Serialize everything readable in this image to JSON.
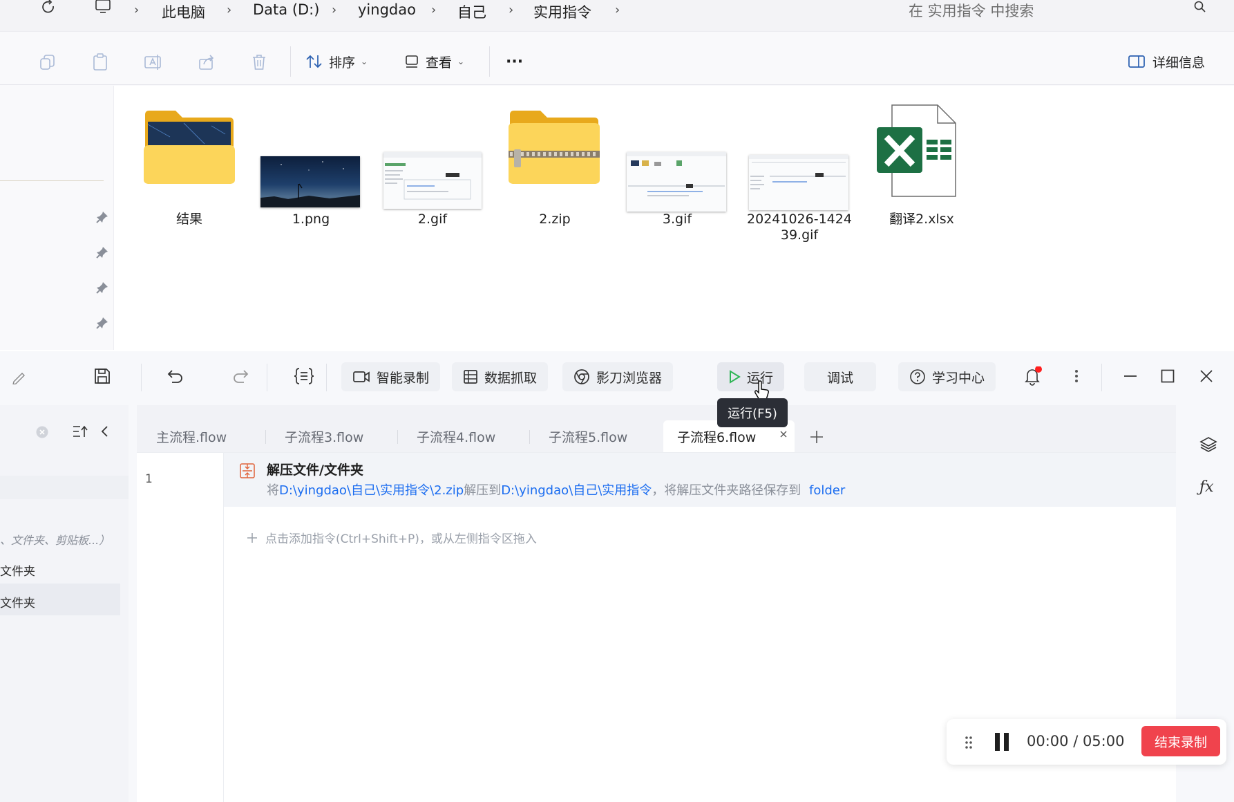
{
  "explorer": {
    "breadcrumb": [
      "此电脑",
      "Data (D:)",
      "yingdao",
      "自己",
      "实用指令"
    ],
    "search_placeholder": "在 实用指令 中搜索",
    "toolbar": {
      "sort_label": "排序",
      "view_label": "查看",
      "more_label": "···",
      "details_label": "详细信息"
    },
    "files": [
      {
        "name": "结果",
        "type": "folder"
      },
      {
        "name": "1.png",
        "type": "image"
      },
      {
        "name": "2.gif",
        "type": "gif"
      },
      {
        "name": "2.zip",
        "type": "zip"
      },
      {
        "name": "3.gif",
        "type": "gif"
      },
      {
        "name": "20241026-142439.gif",
        "name_line1": "20241026-1424",
        "name_line2": "39.gif",
        "type": "gif"
      },
      {
        "name": "翻译2.xlsx",
        "type": "xlsx"
      }
    ]
  },
  "app": {
    "toolbar": {
      "smart_record": "智能录制",
      "data_capture": "数据抓取",
      "browser": "影刀浏览器",
      "run": "运行",
      "debug": "调试",
      "learning_center": "学习中心",
      "run_tooltip": "运行(F5)"
    },
    "left_panel": {
      "hint": "、文件夹、剪贴板...）",
      "items": [
        "文件夹",
        "文件夹"
      ]
    },
    "tabs": [
      {
        "label": "主流程.flow",
        "active": false
      },
      {
        "label": "子流程3.flow",
        "active": false
      },
      {
        "label": "子流程4.flow",
        "active": false
      },
      {
        "label": "子流程5.flow",
        "active": false
      },
      {
        "label": "子流程6.flow",
        "active": true
      }
    ],
    "step": {
      "line_number": "1",
      "title": "解压文件/文件夹",
      "desc_prefix": "将",
      "src_path": "D:\\yingdao\\自己\\实用指令\\2.zip",
      "desc_mid": "解压到",
      "dst_path": "D:\\yingdao\\自己\\实用指令",
      "desc_suffix": "，将解压文件夹路径保存到",
      "var_name": "folder"
    },
    "add_hint": "点击添加指令(Ctrl+Shift+P)，或从左侧指令区拖入",
    "recorder": {
      "time": "00:00 / 05:00",
      "stop_label": "结束录制"
    },
    "colors": {
      "accent_blue": "#1a6cf0",
      "run_green": "#2fb556",
      "stop_red": "#f0434d",
      "notify_red": "#ff1f1f"
    }
  }
}
